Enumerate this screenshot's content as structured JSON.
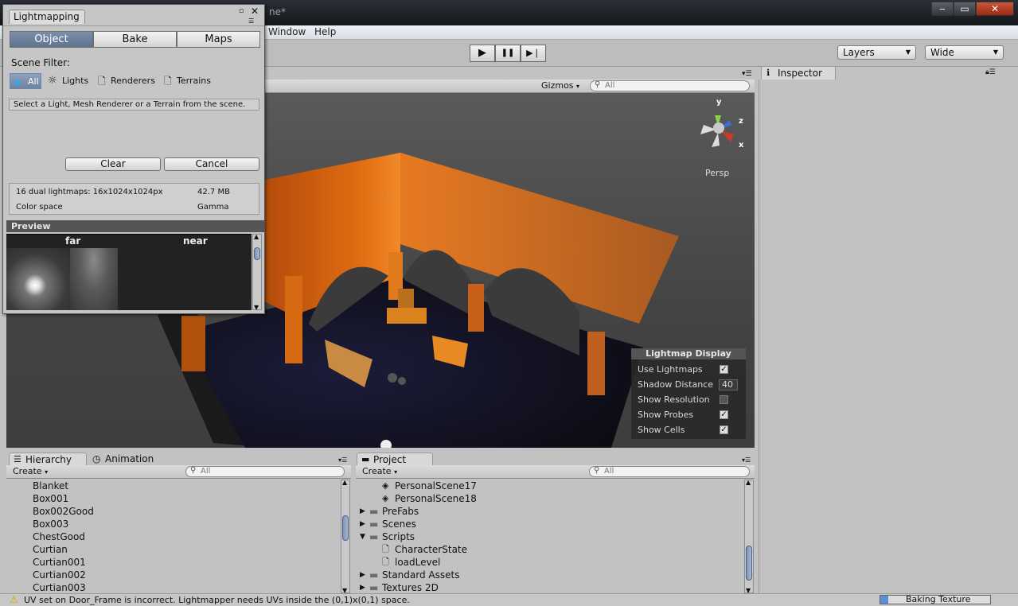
{
  "window": {
    "title": "ne*",
    "min": "‒",
    "max": "▭",
    "close": "✕"
  },
  "menu": {
    "items": [
      "Window",
      "Help"
    ]
  },
  "toolbar": {
    "play": "▶",
    "pause": "❚❚",
    "step": "▶❘",
    "layers": "Layers",
    "layout": "Wide"
  },
  "scene": {
    "gizmos": "Gizmos",
    "search_placeholder": "All",
    "persp": "Persp",
    "axes": {
      "y": "y",
      "z": "z",
      "x": "x"
    },
    "lightmap_display": {
      "title": "Lightmap Display",
      "rows": [
        {
          "label": "Use Lightmaps",
          "checked": "✓"
        },
        {
          "label": "Shadow Distance",
          "value": "40"
        },
        {
          "label": "Show Resolution",
          "checked": ""
        },
        {
          "label": "Show Probes",
          "checked": "✓"
        },
        {
          "label": "Show Cells",
          "checked": "✓"
        }
      ]
    }
  },
  "inspector": {
    "tab": "Inspector"
  },
  "lightmapping": {
    "tab": "Lightmapping",
    "segments": [
      "Object",
      "Bake",
      "Maps"
    ],
    "scene_filter_label": "Scene Filter:",
    "filters": [
      "All",
      "Lights",
      "Renderers",
      "Terrains"
    ],
    "hint": "Select a Light, Mesh Renderer or a Terrain from the scene.",
    "clear": "Clear",
    "cancel": "Cancel",
    "info": {
      "lightmaps": "16 dual lightmaps: 16x1024x1024px",
      "size": "42.7 MB",
      "colorspace_label": "Color space",
      "colorspace": "Gamma"
    },
    "preview": {
      "title": "Preview",
      "far": "far",
      "near": "near"
    }
  },
  "hierarchy": {
    "tab": "Hierarchy",
    "tab2": "Animation",
    "create": "Create",
    "search_placeholder": "All",
    "items": [
      "Blanket",
      "Box001",
      "Box002Good",
      "Box003",
      "ChestGood",
      "Curtian",
      "Curtian001",
      "Curtian002",
      "Curtian003"
    ]
  },
  "project": {
    "tab": "Project",
    "create": "Create",
    "search_placeholder": "All",
    "items": [
      {
        "label": "PersonalScene17",
        "icon": "unity-scene-icon"
      },
      {
        "label": "PersonalScene18",
        "icon": "unity-scene-icon"
      },
      {
        "label": "PreFabs",
        "icon": "folder-icon"
      },
      {
        "label": "Scenes",
        "icon": "folder-icon"
      },
      {
        "label": "Scripts",
        "icon": "folder-icon"
      },
      {
        "label": "CharacterState",
        "icon": "script-icon"
      },
      {
        "label": "loadLevel",
        "icon": "script-icon"
      },
      {
        "label": "Standard Assets",
        "icon": "folder-icon"
      },
      {
        "label": "Textures 2D",
        "icon": "folder-icon"
      }
    ]
  },
  "status": {
    "message": "UV set on Door_Frame is incorrect. Lightmapper needs UVs inside the (0,1)x(0,1) space.",
    "progress_label": "Baking Texture"
  }
}
